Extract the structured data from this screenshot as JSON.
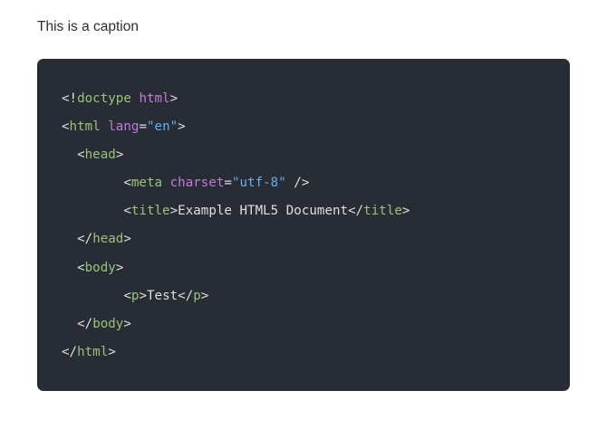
{
  "caption": "This is a caption",
  "colors": {
    "background": "#282c34",
    "punctuation": "#dcdfe4",
    "tag": "#98c379",
    "attribute": "#c678dd",
    "string": "#61afef",
    "text": "#dcdfe4"
  },
  "code": {
    "lines": [
      [
        {
          "t": "punct",
          "v": "<!"
        },
        {
          "t": "tag",
          "v": "doctype"
        },
        {
          "t": "text",
          "v": " "
        },
        {
          "t": "attr",
          "v": "html"
        },
        {
          "t": "punct",
          "v": ">"
        }
      ],
      [
        {
          "t": "punct",
          "v": "<"
        },
        {
          "t": "tag",
          "v": "html"
        },
        {
          "t": "text",
          "v": " "
        },
        {
          "t": "attr",
          "v": "lang"
        },
        {
          "t": "punct",
          "v": "="
        },
        {
          "t": "str",
          "v": "\"en\""
        },
        {
          "t": "punct",
          "v": ">"
        }
      ],
      [
        {
          "t": "text",
          "v": "  "
        },
        {
          "t": "punct",
          "v": "<"
        },
        {
          "t": "tag",
          "v": "head"
        },
        {
          "t": "punct",
          "v": ">"
        }
      ],
      [
        {
          "t": "text",
          "v": "        "
        },
        {
          "t": "punct",
          "v": "<"
        },
        {
          "t": "tag",
          "v": "meta"
        },
        {
          "t": "text",
          "v": " "
        },
        {
          "t": "attr",
          "v": "charset"
        },
        {
          "t": "punct",
          "v": "="
        },
        {
          "t": "str",
          "v": "\"utf-8\""
        },
        {
          "t": "text",
          "v": " "
        },
        {
          "t": "punct",
          "v": "/>"
        }
      ],
      [
        {
          "t": "text",
          "v": "        "
        },
        {
          "t": "punct",
          "v": "<"
        },
        {
          "t": "tag",
          "v": "title"
        },
        {
          "t": "punct",
          "v": ">"
        },
        {
          "t": "text",
          "v": "Example HTML5 Document"
        },
        {
          "t": "punct",
          "v": "</"
        },
        {
          "t": "tag",
          "v": "title"
        },
        {
          "t": "punct",
          "v": ">"
        }
      ],
      [
        {
          "t": "text",
          "v": "  "
        },
        {
          "t": "punct",
          "v": "</"
        },
        {
          "t": "tag",
          "v": "head"
        },
        {
          "t": "punct",
          "v": ">"
        }
      ],
      [
        {
          "t": "text",
          "v": "  "
        },
        {
          "t": "punct",
          "v": "<"
        },
        {
          "t": "tag",
          "v": "body"
        },
        {
          "t": "punct",
          "v": ">"
        }
      ],
      [
        {
          "t": "text",
          "v": "        "
        },
        {
          "t": "punct",
          "v": "<"
        },
        {
          "t": "tag",
          "v": "p"
        },
        {
          "t": "punct",
          "v": ">"
        },
        {
          "t": "text",
          "v": "Test"
        },
        {
          "t": "punct",
          "v": "</"
        },
        {
          "t": "tag",
          "v": "p"
        },
        {
          "t": "punct",
          "v": ">"
        }
      ],
      [
        {
          "t": "text",
          "v": "  "
        },
        {
          "t": "punct",
          "v": "</"
        },
        {
          "t": "tag",
          "v": "body"
        },
        {
          "t": "punct",
          "v": ">"
        }
      ],
      [
        {
          "t": "punct",
          "v": "</"
        },
        {
          "t": "tag",
          "v": "html"
        },
        {
          "t": "punct",
          "v": ">"
        }
      ]
    ]
  }
}
